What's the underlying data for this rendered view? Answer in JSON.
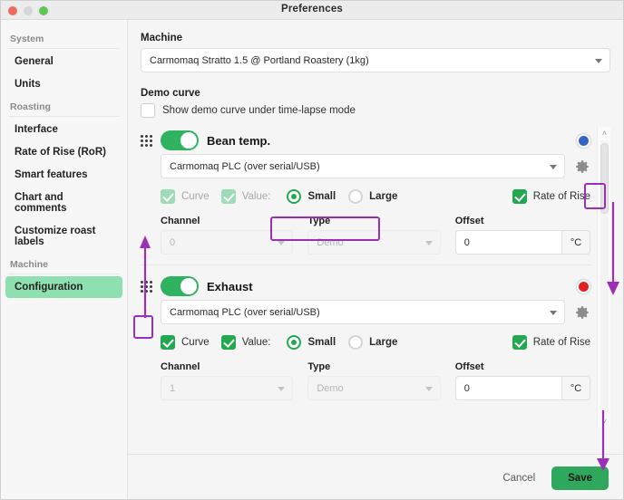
{
  "window": {
    "title": "Preferences",
    "traffic_lights": [
      "close-light",
      "minimize-light",
      "maximize-light"
    ]
  },
  "sidebar": {
    "groups": [
      {
        "label": "System",
        "items": [
          {
            "label": "General",
            "active": false
          },
          {
            "label": "Units",
            "active": false
          }
        ]
      },
      {
        "label": "Roasting",
        "items": [
          {
            "label": "Interface",
            "active": false
          },
          {
            "label": "Rate of Rise (RoR)",
            "active": false
          },
          {
            "label": "Smart features",
            "active": false
          },
          {
            "label": "Chart and comments",
            "active": false
          },
          {
            "label": "Customize roast labels",
            "active": false
          }
        ]
      },
      {
        "label": "Machine",
        "items": [
          {
            "label": "Configuration",
            "active": true
          }
        ]
      }
    ]
  },
  "main": {
    "machine": {
      "label": "Machine",
      "value": "Carmomaq Stratto 1.5 @ Portland Roastery (1kg)"
    },
    "demo_curve": {
      "label": "Demo curve",
      "checkbox_label": "Show demo curve under time-lapse mode",
      "checked": false
    },
    "channels": [
      {
        "name": "Bean temp.",
        "enabled": true,
        "color": "#3465c4",
        "color_name": "blue-dot",
        "device": "Carmomaq PLC (over serial/USB)",
        "curve": {
          "label": "Curve",
          "checked": true,
          "disabled": true
        },
        "value": {
          "label": "Value:",
          "checked": true,
          "disabled": true
        },
        "size": {
          "small": "Small",
          "large": "Large",
          "selected": "Small"
        },
        "rate_of_rise": {
          "label": "Rate of Rise",
          "checked": true,
          "disabled": false
        },
        "channel": {
          "label": "Channel",
          "value": "0",
          "disabled": true
        },
        "type": {
          "label": "Type",
          "value": "Demo",
          "disabled": true
        },
        "offset": {
          "label": "Offset",
          "value": "0",
          "unit": "°C"
        }
      },
      {
        "name": "Exhaust",
        "enabled": true,
        "color": "#e02121",
        "color_name": "red-dot",
        "device": "Carmomaq PLC (over serial/USB)",
        "curve": {
          "label": "Curve",
          "checked": true,
          "disabled": false
        },
        "value": {
          "label": "Value:",
          "checked": true,
          "disabled": false
        },
        "size": {
          "small": "Small",
          "large": "Large",
          "selected": "Small"
        },
        "rate_of_rise": {
          "label": "Rate of Rise",
          "checked": true,
          "disabled": false
        },
        "channel": {
          "label": "Channel",
          "value": "1",
          "disabled": true
        },
        "type": {
          "label": "Type",
          "value": "Demo",
          "disabled": true
        },
        "offset": {
          "label": "Offset",
          "value": "0",
          "unit": "°C"
        }
      }
    ]
  },
  "footer": {
    "cancel": "Cancel",
    "save": "Save"
  },
  "annotations": {
    "color": "#9b30b5",
    "highlights": [
      "small-large-radio-group",
      "bean-temp-gear-icon",
      "exhaust-drag-handle"
    ],
    "arrows": [
      "drag-handle-move-up",
      "scrollbar-scroll-down",
      "save-button-pointer"
    ]
  },
  "scrollbar": {
    "up": "˄",
    "down": "˅"
  }
}
